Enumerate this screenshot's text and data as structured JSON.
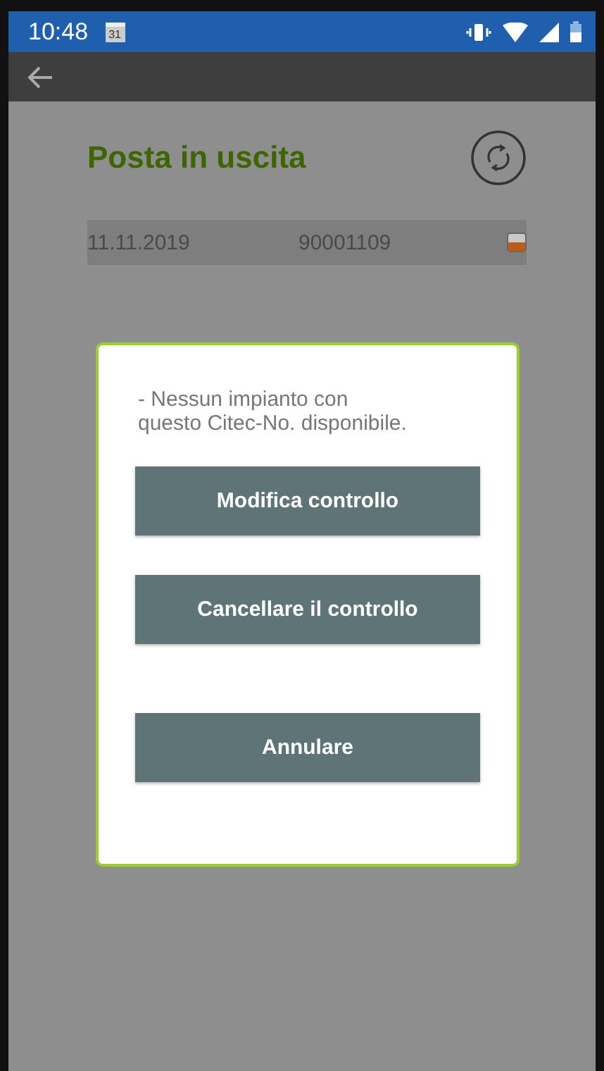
{
  "status_bar": {
    "time": "10:48",
    "calendar_day": "31"
  },
  "page": {
    "title": "Posta in uscita"
  },
  "rows": [
    {
      "date": "11.11.2019",
      "number": "90001109"
    }
  ],
  "dialog": {
    "message": "- Nessun impianto con questo Citec-No. disponibile.",
    "buttons": [
      {
        "label": "Modifica controllo",
        "kind": "action"
      },
      {
        "label": "Cancellare il controllo",
        "kind": "action"
      },
      {
        "label": "Annulare",
        "kind": "cancel"
      }
    ]
  }
}
